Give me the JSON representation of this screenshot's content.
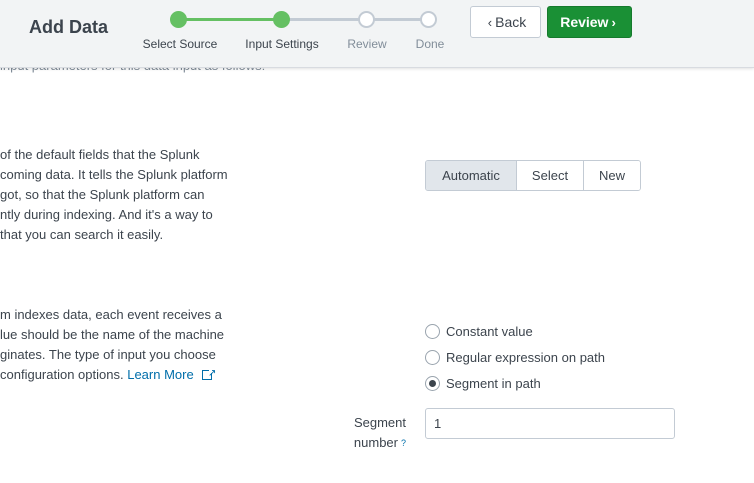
{
  "header": {
    "title": "Add Data",
    "steps": [
      {
        "label": "Select Source",
        "state": "done"
      },
      {
        "label": "Input Settings",
        "state": "done"
      },
      {
        "label": "Review",
        "state": "pending"
      },
      {
        "label": "Done",
        "state": "pending"
      }
    ],
    "back_label": "Back",
    "review_label": "Review"
  },
  "intro_partial": "input parameters for this data input as follows:",
  "source_type": {
    "description_lines": [
      "of the default fields that the Splunk",
      "coming data. It tells the Splunk platform",
      "got, so that the Splunk platform can",
      "ntly during indexing. And it's a way to",
      "that you can search it easily."
    ],
    "options": [
      "Automatic",
      "Select",
      "New"
    ],
    "selected": "Automatic"
  },
  "host": {
    "description_lines": [
      "m indexes data, each event receives a",
      "lue should be the name of the machine",
      "ginates. The type of input you choose",
      "configuration options."
    ],
    "learn_more": "Learn More",
    "radio_options": [
      "Constant value",
      "Regular expression on path",
      "Segment in path"
    ],
    "selected": "Segment in path",
    "segment_label_1": "Segment",
    "segment_label_2": "number",
    "help_mark": "?",
    "segment_value": "1"
  },
  "colors": {
    "step_done": "#65c063",
    "step_pending": "#c3cbd4",
    "primary_button": "#1a9035",
    "link": "#006eaa"
  }
}
